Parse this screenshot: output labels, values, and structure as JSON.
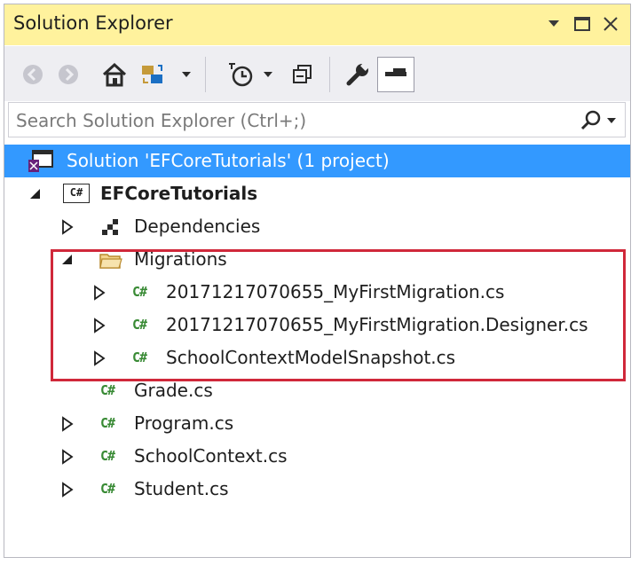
{
  "window": {
    "title": "Solution Explorer"
  },
  "search": {
    "placeholder": "Search Solution Explorer (Ctrl+;)"
  },
  "tree": {
    "solution_label": "Solution 'EFCoreTutorials' (1 project)",
    "project_label": "EFCoreTutorials",
    "dependencies_label": "Dependencies",
    "migrations_label": "Migrations",
    "migration_files": [
      "20171217070655_MyFirstMigration.cs",
      "20171217070655_MyFirstMigration.Designer.cs",
      "SchoolContextModelSnapshot.cs"
    ],
    "files": [
      "Grade.cs",
      "Program.cs",
      "SchoolContext.cs",
      "Student.cs"
    ],
    "cs_icon_text": "C#",
    "project_icon_text": "C#"
  },
  "colors": {
    "titlebar": "#fff29d",
    "selection": "#3399ff",
    "highlight_border": "#d0283a",
    "cs_green": "#388a34"
  }
}
